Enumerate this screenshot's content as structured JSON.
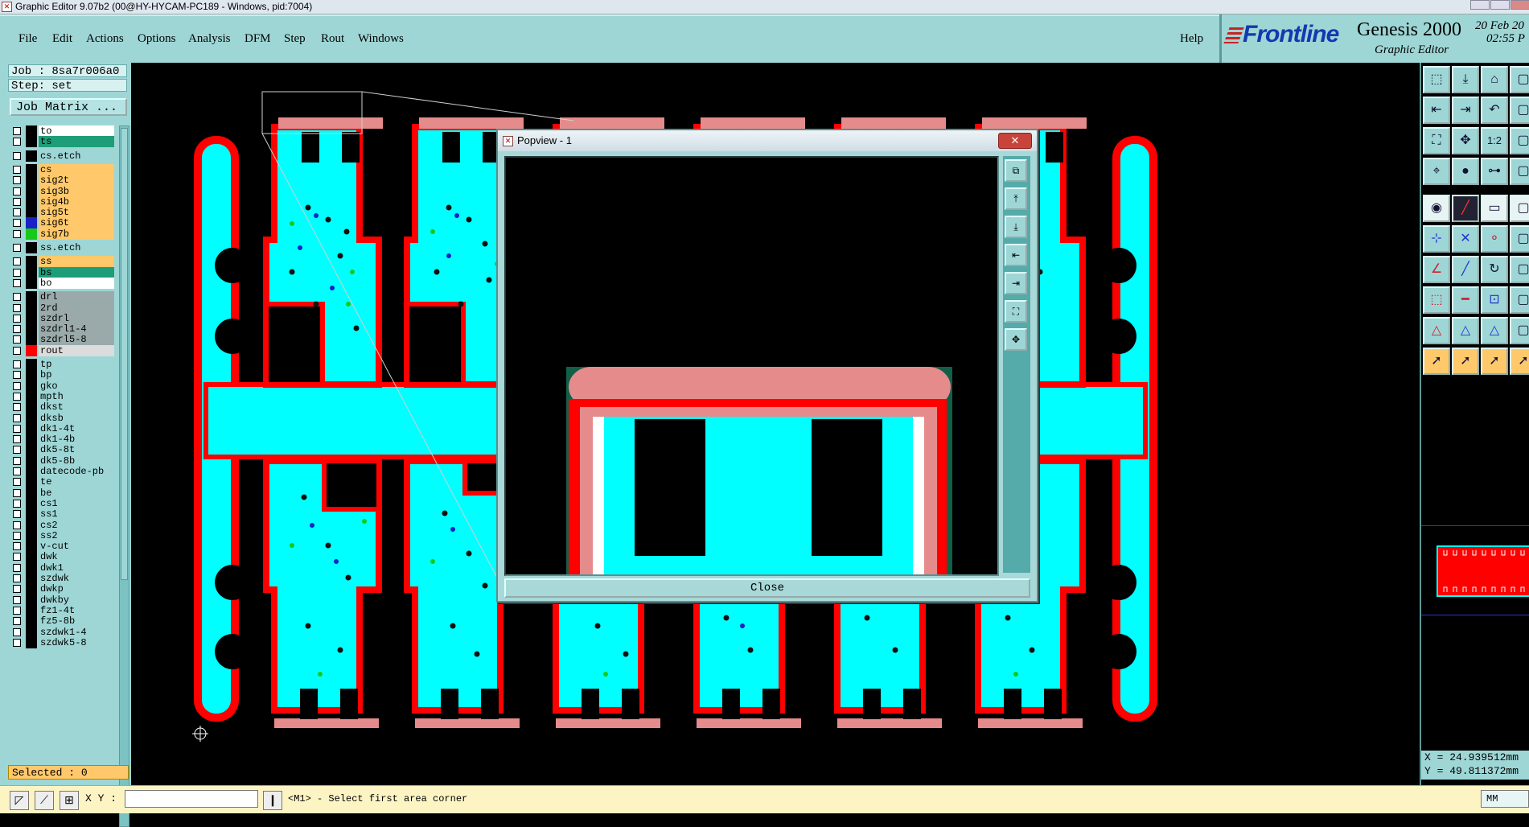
{
  "window": {
    "title": "Graphic Editor 9.07b2 (00@HY-HYCAM-PC189 - Windows, pid:7004)"
  },
  "menu": {
    "items": [
      "File",
      "Edit",
      "Actions",
      "Options",
      "Analysis",
      "DFM",
      "Step",
      "Rout",
      "Windows"
    ],
    "help": "Help"
  },
  "brand": {
    "logo": "Frontline",
    "product": "Genesis 2000",
    "subtitle": "Graphic Editor",
    "date": "20 Feb 20",
    "time": "02:55 P"
  },
  "job": {
    "job_label": "Job : 8sa7r006a0",
    "step_label": "Step: set",
    "matrix_button": "Job Matrix ..."
  },
  "layers": [
    {
      "name": "to",
      "color": "#ffffff",
      "swatch": "#000000"
    },
    {
      "name": "ts",
      "color": "#1e9e78",
      "swatch": "#000000"
    },
    {
      "name": "cs.etch",
      "color": "#9ed6d6",
      "swatch": "#000000",
      "gap": true
    },
    {
      "name": "cs",
      "color": "#ffc86a",
      "swatch": "#000000",
      "gap": true
    },
    {
      "name": "sig2t",
      "color": "#ffc86a",
      "swatch": "#000000"
    },
    {
      "name": "sig3b",
      "color": "#ffc86a",
      "swatch": "#000000"
    },
    {
      "name": "sig4b",
      "color": "#ffc86a",
      "swatch": "#000000"
    },
    {
      "name": "sig5t",
      "color": "#ffc86a",
      "swatch": "#000000"
    },
    {
      "name": "sig6t",
      "color": "#ffc86a",
      "swatch": "#1822c8"
    },
    {
      "name": "sig7b",
      "color": "#ffc86a",
      "swatch": "#18c818"
    },
    {
      "name": "ss.etch",
      "color": "#9ed6d6",
      "swatch": "#000000",
      "gap": true
    },
    {
      "name": "ss",
      "color": "#ffc86a",
      "swatch": "#000000",
      "gap": true
    },
    {
      "name": "bs",
      "color": "#1e9e78",
      "swatch": "#000000"
    },
    {
      "name": "bo",
      "color": "#ffffff",
      "swatch": "#000000"
    },
    {
      "name": "drl",
      "color": "#9aaaaa",
      "swatch": "#000000",
      "gap": true
    },
    {
      "name": "2rd",
      "color": "#9aaaaa",
      "swatch": "#000000"
    },
    {
      "name": "szdrl",
      "color": "#9aaaaa",
      "swatch": "#000000"
    },
    {
      "name": "szdrl1-4",
      "color": "#9aaaaa",
      "swatch": "#000000"
    },
    {
      "name": "szdrl5-8",
      "color": "#9aaaaa",
      "swatch": "#000000"
    },
    {
      "name": "rout",
      "color": "#dcdcdc",
      "swatch": "#ff0000"
    },
    {
      "name": "tp",
      "color": "#9ed6d6",
      "swatch": "#000000",
      "gap": true
    },
    {
      "name": "bp",
      "color": "#9ed6d6",
      "swatch": "#000000"
    },
    {
      "name": "gko",
      "color": "#9ed6d6",
      "swatch": "#000000"
    },
    {
      "name": "mpth",
      "color": "#9ed6d6",
      "swatch": "#000000"
    },
    {
      "name": "dkst",
      "color": "#9ed6d6",
      "swatch": "#000000"
    },
    {
      "name": "dksb",
      "color": "#9ed6d6",
      "swatch": "#000000"
    },
    {
      "name": "dk1-4t",
      "color": "#9ed6d6",
      "swatch": "#000000"
    },
    {
      "name": "dk1-4b",
      "color": "#9ed6d6",
      "swatch": "#000000"
    },
    {
      "name": "dk5-8t",
      "color": "#9ed6d6",
      "swatch": "#000000"
    },
    {
      "name": "dk5-8b",
      "color": "#9ed6d6",
      "swatch": "#000000"
    },
    {
      "name": "datecode-pb",
      "color": "#9ed6d6",
      "swatch": "#000000"
    },
    {
      "name": "te",
      "color": "#9ed6d6",
      "swatch": "#000000"
    },
    {
      "name": "be",
      "color": "#9ed6d6",
      "swatch": "#000000"
    },
    {
      "name": "cs1",
      "color": "#9ed6d6",
      "swatch": "#000000"
    },
    {
      "name": "ss1",
      "color": "#9ed6d6",
      "swatch": "#000000"
    },
    {
      "name": "cs2",
      "color": "#9ed6d6",
      "swatch": "#000000"
    },
    {
      "name": "ss2",
      "color": "#9ed6d6",
      "swatch": "#000000"
    },
    {
      "name": "v-cut",
      "color": "#9ed6d6",
      "swatch": "#000000"
    },
    {
      "name": "dwk",
      "color": "#9ed6d6",
      "swatch": "#000000"
    },
    {
      "name": "dwk1",
      "color": "#9ed6d6",
      "swatch": "#000000"
    },
    {
      "name": "szdwk",
      "color": "#9ed6d6",
      "swatch": "#000000"
    },
    {
      "name": "dwkp",
      "color": "#9ed6d6",
      "swatch": "#000000"
    },
    {
      "name": "dwkby",
      "color": "#9ed6d6",
      "swatch": "#000000"
    },
    {
      "name": "fz1-4t",
      "color": "#9ed6d6",
      "swatch": "#000000"
    },
    {
      "name": "fz5-8b",
      "color": "#9ed6d6",
      "swatch": "#000000"
    },
    {
      "name": "szdwk1-4",
      "color": "#9ed6d6",
      "swatch": "#000000"
    },
    {
      "name": "szdwk5-8",
      "color": "#9ed6d6",
      "swatch": "#000000"
    }
  ],
  "selected": "Selected : 0",
  "coords": {
    "x": "X = 24.939512mm",
    "y": "Y = 49.811372mm"
  },
  "statusbar": {
    "xy_label": "X Y :",
    "xy_value": "",
    "prompt": "<M1> - Select first area corner",
    "units": "MM"
  },
  "popview": {
    "title": "Popview - 1",
    "close_button": "Close"
  },
  "colors": {
    "board": "#00ffff",
    "rout": "#ff0000",
    "mask": "#e58b8b",
    "panel_bg": "#9ed6d6",
    "highlight": "#ffc86a"
  }
}
